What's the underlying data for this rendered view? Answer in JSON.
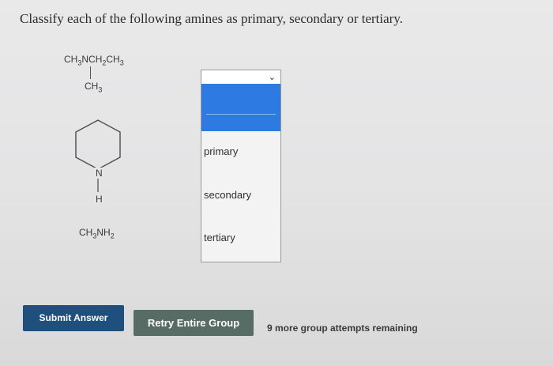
{
  "question": "Classify each of the following amines as primary, secondary or tertiary.",
  "compounds": {
    "c1_main": "CH3NCH2CH3",
    "c1_branch": "CH3",
    "c2_n": "N",
    "c2_h": "H",
    "c3": "CH3NH2"
  },
  "dropdown": {
    "selected": "",
    "options": [
      "",
      "primary",
      "secondary",
      "tertiary"
    ],
    "option_primary": "primary",
    "option_secondary": "secondary",
    "option_tertiary": "tertiary",
    "highlight_color": "#2d7be2"
  },
  "buttons": {
    "submit": "Submit Answer",
    "retry": "Retry Entire Group",
    "submit_color": "#1f4f7d",
    "retry_color": "#566c64"
  },
  "attempts_text": "9 more group attempts remaining"
}
